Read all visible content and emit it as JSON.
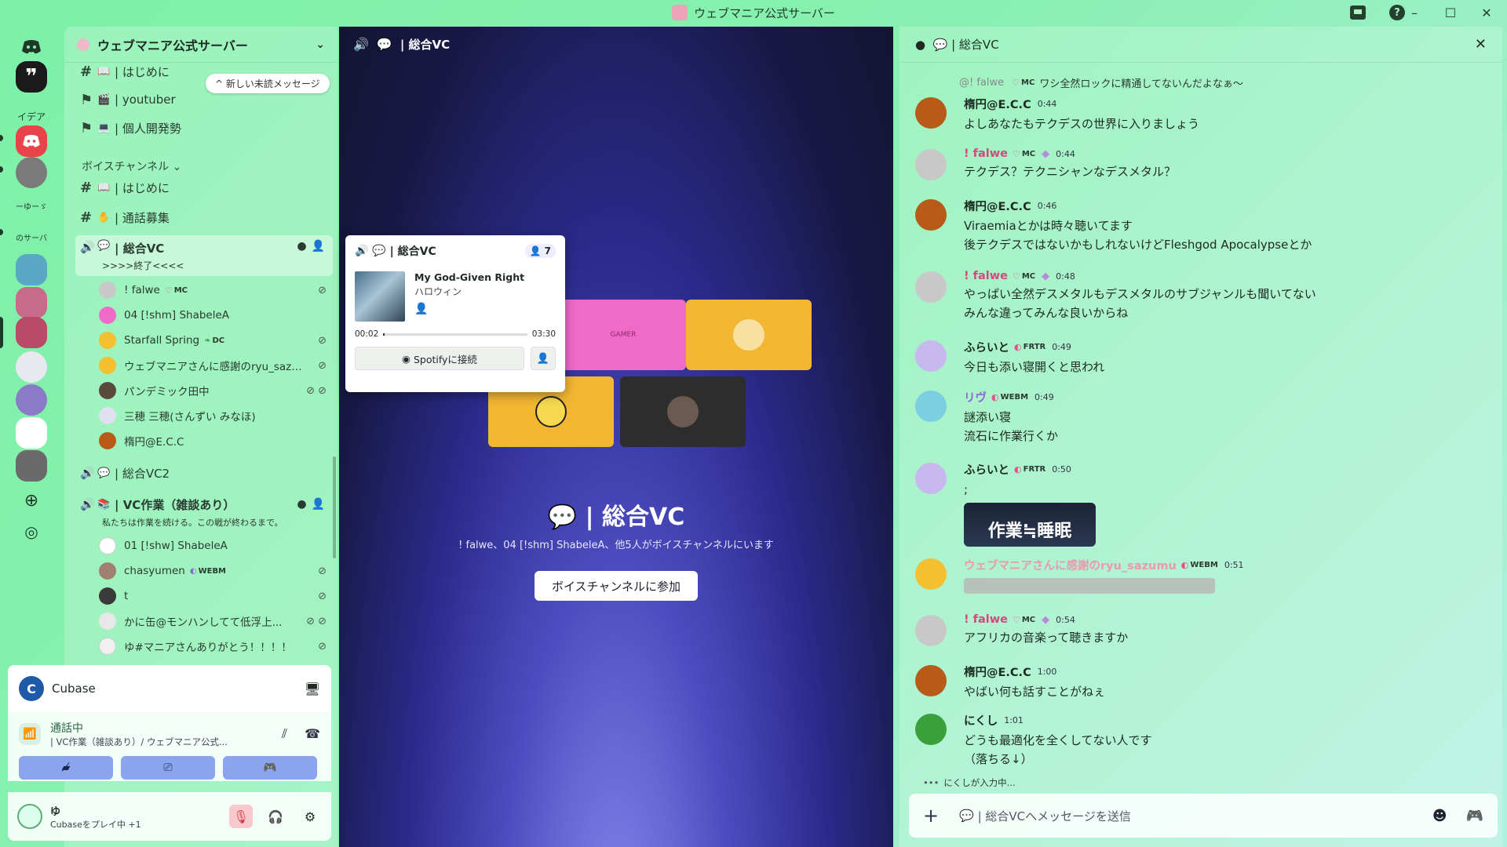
{
  "window": {
    "title": "ウェブマニア公式サーバー",
    "controls": [
      "minimize-icon",
      "maximize-icon",
      "close-icon"
    ]
  },
  "rail": {
    "servers": [
      {
        "label": "",
        "icon": "discord-icon"
      },
      {
        "label": "",
        "icon": "quote-icon"
      },
      {
        "label": "イデア",
        "icon": ""
      },
      {
        "label": "",
        "icon": "discord-icon"
      },
      {
        "label": "",
        "icon": "avatar"
      },
      {
        "label": "ーゆーゞ",
        "icon": ""
      },
      {
        "label": "のサーバ",
        "icon": ""
      },
      {
        "label": "",
        "icon": "add-server-icon"
      },
      {
        "label": "",
        "icon": "explore-icon"
      }
    ]
  },
  "sidebar": {
    "server_name": "ウェブマニア公式サーバー",
    "new_messages": "新しい未読メッセージ",
    "text_channels": [
      {
        "name": "| はじめに"
      },
      {
        "name": "| youtuber"
      },
      {
        "name": "| 個人開発勢"
      }
    ],
    "voice_category": "ボイスチャンネル",
    "voice_text_channels": [
      {
        "name": "| はじめに"
      },
      {
        "name": "| 通話募集"
      }
    ],
    "vc_main": {
      "name": "| 総合VC",
      "status": ">>>>終了<<<<",
      "users": [
        {
          "name": "! falwe",
          "tag": "MC",
          "muted": true
        },
        {
          "name": "04 [!shm] ShabeleA",
          "tag": "",
          "muted": false
        },
        {
          "name": "Starfall Spring",
          "tag": "DC",
          "muted": true
        },
        {
          "name": "ウェブマニアさんに感謝のryu_sazumu",
          "tag": "",
          "muted": true
        },
        {
          "name": "パンデミック田中",
          "tag": "",
          "muted": true
        },
        {
          "name": "三穂 三穂(さんずい みなほ)",
          "tag": "",
          "muted": false
        },
        {
          "name": "楕円@E.C.C",
          "tag": "",
          "muted": false
        }
      ]
    },
    "vc2": {
      "name": "| 総合VC2"
    },
    "vc_work": {
      "name": "| VC作業（雑談あり）",
      "status": "私たちは作業を続ける。この戦が終わるまで。",
      "users": [
        {
          "name": "01 [!shw] ShabeleA",
          "tag": "",
          "muted": false
        },
        {
          "name": "chasyumen",
          "tag": "WEBM",
          "muted": true
        },
        {
          "name": "t",
          "tag": "",
          "muted": true
        },
        {
          "name": "かに缶@モンハンしてて低浮上...",
          "tag": "",
          "muted": true
        },
        {
          "name": "ゆ#マニアさんありがとう！！！！",
          "tag": "",
          "muted": true
        }
      ]
    }
  },
  "activity": {
    "app": "Cubase"
  },
  "voice_panel": {
    "status": "通話中",
    "channel": "| VC作業（雑談あり）/ ウェブマニア公式..."
  },
  "user_panel": {
    "name": "ゆ",
    "activity": "Cubaseをプレイ中 +1"
  },
  "center": {
    "channel": "| 総合VC",
    "title": "| 総合VC",
    "subtitle": "! falwe、04 [!shm] ShabeleA、他5人がボイスチャンネルにいます",
    "join_label": "ボイスチャンネルに参加",
    "tiles": [
      {
        "color": "#f06ac8",
        "label": "GAMER"
      },
      {
        "color": "#f2b632",
        "label": ""
      },
      {
        "color": "#f2b632",
        "label": ""
      },
      {
        "color": "#2d2d2d",
        "label": ""
      }
    ]
  },
  "popup": {
    "channel": "| 総合VC",
    "count": "7",
    "track_title": "My God-Given Right",
    "track_artist": "ハロウィン",
    "time_current": "00:02",
    "time_total": "03:30",
    "progress": 0.01,
    "spotify_label": "Spotifyに接続"
  },
  "chat": {
    "channel": "| 総合VC",
    "reply": {
      "author": "@! falwe",
      "tag": "MC",
      "text": "ワシ全然ロックに精通してないんだよなぁ～"
    },
    "messages": [
      {
        "author": "楕円@E.C.C",
        "time": "0:44",
        "tag": "",
        "lines": [
          "よしあなたもテクデスの世界に入りましょう"
        ],
        "color": "#1c2a22",
        "avatar": "#b85a18"
      },
      {
        "author": "! falwe",
        "time": "0:44",
        "tag": "MC",
        "lines": [
          "テクデス？テクニシャンなデスメタル？"
        ],
        "color": "#d4487e",
        "avatar": "#c8c8c8"
      },
      {
        "author": "楕円@E.C.C",
        "time": "0:46",
        "tag": "",
        "lines": [
          "Viraemiaとかは時々聴いてます",
          "後テクデスではないかもしれないけどFleshgod Apocalypseとか"
        ],
        "color": "#1c2a22",
        "avatar": "#b85a18"
      },
      {
        "author": "! falwe",
        "time": "0:48",
        "tag": "MC",
        "lines": [
          "やっぱい全然デスメタルもデスメタルのサブジャンルも聞いてない",
          "みんな違ってみんな良いからね"
        ],
        "color": "#d4487e",
        "avatar": "#c8c8c8"
      },
      {
        "author": "ふらいと",
        "time": "0:49",
        "tag": "FRTR",
        "lines": [
          "今日も添い寝開くと思われ"
        ],
        "color": "#1c2a22",
        "avatar": "#c8b8f0"
      },
      {
        "author": "リヴ",
        "time": "0:49",
        "tag": "WEBM",
        "lines": [
          "謎添い寝",
          "流石に作業行くか"
        ],
        "color": "#8a6ad0",
        "avatar": "#7ad0e0"
      },
      {
        "author": "ふらいと",
        "time": "0:50",
        "tag": "FRTR",
        "lines": [
          ";"
        ],
        "color": "#1c2a22",
        "avatar": "#c8b8f0",
        "image": "作業≒睡眠"
      },
      {
        "author": "ウェブマニアさんに感謝のryu_sazumu",
        "time": "0:51",
        "tag": "WEBM",
        "lines": [],
        "color": "#e89ab0",
        "avatar": "#f2c030",
        "blurred": true
      },
      {
        "author": "! falwe",
        "time": "0:54",
        "tag": "MC",
        "lines": [
          "アフリカの音楽って聴きますか"
        ],
        "color": "#d4487e",
        "avatar": "#c8c8c8"
      },
      {
        "author": "楕円@E.C.C",
        "time": "1:00",
        "tag": "",
        "lines": [
          "やばい何も話すことがねぇ"
        ],
        "color": "#1c2a22",
        "avatar": "#b85a18"
      },
      {
        "author": "にくし",
        "time": "1:01",
        "tag": "",
        "lines": [
          "どうも最適化を全くしてない人です",
          "（落ちる↓）"
        ],
        "color": "#1c2a22",
        "avatar": "#3aa03a"
      }
    ],
    "typing": "にくしが入力中...",
    "input_placeholder": "| 総合VCへメッセージを送信"
  }
}
